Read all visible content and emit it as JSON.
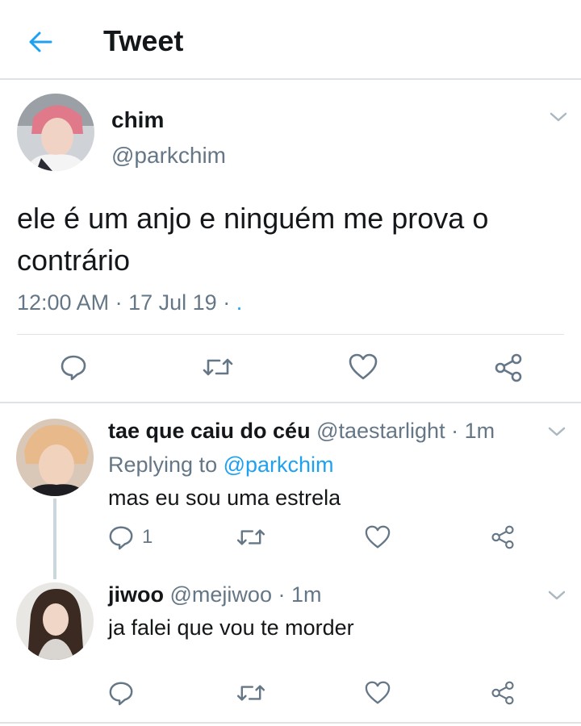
{
  "header": {
    "title": "Tweet"
  },
  "main_tweet": {
    "name": "chim",
    "handle": "@parkchim",
    "text": "ele é um anjo e ninguém me prova o contrário",
    "time": "12:00 AM",
    "date": "17 Jul 19",
    "sep1": "·",
    "sep2": "·",
    "source": "."
  },
  "replies": [
    {
      "name": "tae que caiu do céu",
      "handle": "@taestarlight",
      "sep": "·",
      "time": "1m",
      "replying_label": "Replying to",
      "replying_to": "@parkchim",
      "text": "mas eu sou uma estrela",
      "reply_count": "1"
    },
    {
      "name": "jiwoo",
      "handle": "@mejiwoo",
      "sep": "·",
      "time": "1m",
      "text": "ja falei que vou te morder"
    }
  ],
  "colors": {
    "accent": "#1da1f2",
    "secondary_text": "#657786",
    "divider": "#dfe3e6",
    "icon": "#657786"
  },
  "icons": {
    "back": "arrow-left-icon",
    "more": "chevron-down-icon",
    "reply": "speech-bubble-icon",
    "retweet": "retweet-icon",
    "like": "heart-icon",
    "share": "share-icon"
  }
}
